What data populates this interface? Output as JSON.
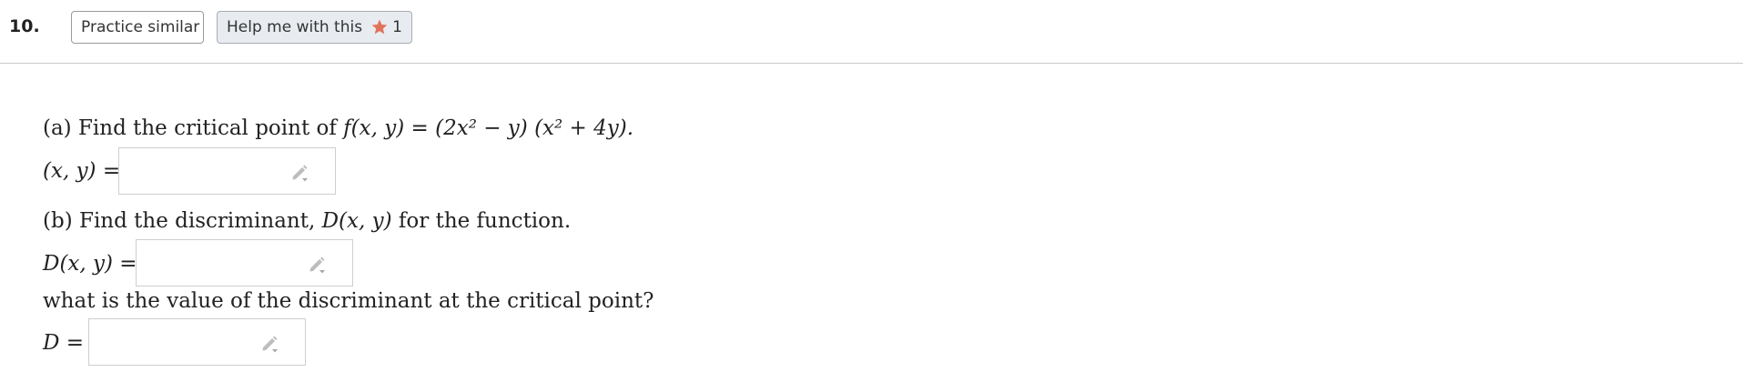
{
  "header": {
    "question_number": "10.",
    "practice_label": "Practice similar",
    "help_label": "Help me with this",
    "help_count": "1",
    "star_color": "#e2725b"
  },
  "question": {
    "part_a": {
      "prefix": "(a) Find the critical point of ",
      "function": "f(x, y) = (2x² − y) (x² + 4y).",
      "answer_label": "(x, y) ="
    },
    "part_b": {
      "prompt_prefix": "(b) Find the discriminant, ",
      "prompt_math": "D(x, y)",
      "prompt_suffix": " for the function.",
      "answer_label": "D(x, y) =",
      "followup": "what is the value of the discriminant at the critical point?",
      "value_label": "D ="
    }
  },
  "icons": {
    "star": "star-icon",
    "pencil": "pencil-dropdown-icon"
  }
}
